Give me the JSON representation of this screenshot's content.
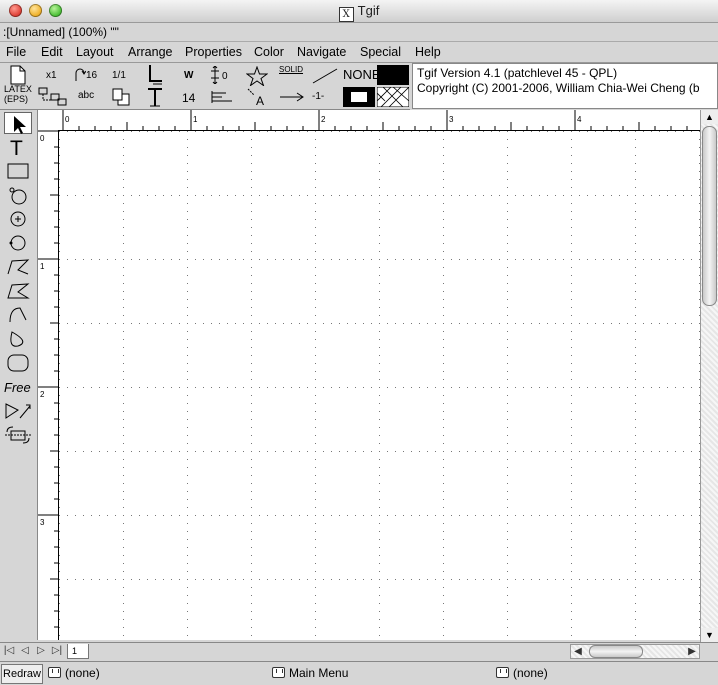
{
  "window": {
    "title": "Tgif",
    "x_glyph": "X"
  },
  "doc": {
    "name": ":[Unnamed] (100%) \"\""
  },
  "menubar": {
    "items": [
      "File",
      "Edit",
      "Layout",
      "Arrange",
      "Properties",
      "Color",
      "Navigate",
      "Special",
      "Help"
    ]
  },
  "toolbar": {
    "zoom_x1": "x1",
    "rotate_16": "16",
    "ratio": "1/1",
    "width_w": "W",
    "spacing_0": "0",
    "line_style": "SOLID",
    "fill_none": "NONE",
    "latex": "LATEX",
    "eps": "(EPS)",
    "text_abc": "abc",
    "font_size": "14",
    "line_dash": "-1-"
  },
  "messages": {
    "line1": "Tgif Version 4.1 (patchlevel 45 - QPL)",
    "line2": "Copyright (C) 2001-2006, William Chia-Wei Cheng (b"
  },
  "tools": [
    "select",
    "text",
    "rectangle",
    "oval-center",
    "oval-corner",
    "oval-edge",
    "polyline",
    "polygon",
    "arc",
    "rcbox-closed",
    "rounded-box",
    "freehand",
    "vertex-mode",
    "rotate-mode"
  ],
  "rulers": {
    "h_labels": [
      "0",
      "1",
      "2",
      "3",
      "4"
    ],
    "v_labels": [
      "0",
      "1",
      "2",
      "3"
    ]
  },
  "pages": {
    "current": "1"
  },
  "status": {
    "redraw": "Redraw",
    "left": "(none)",
    "middle": "Main Menu",
    "right": "(none)"
  },
  "colors": {
    "accent": "#000000",
    "panel": "#d6d6d6",
    "canvas": "#ffffff"
  }
}
